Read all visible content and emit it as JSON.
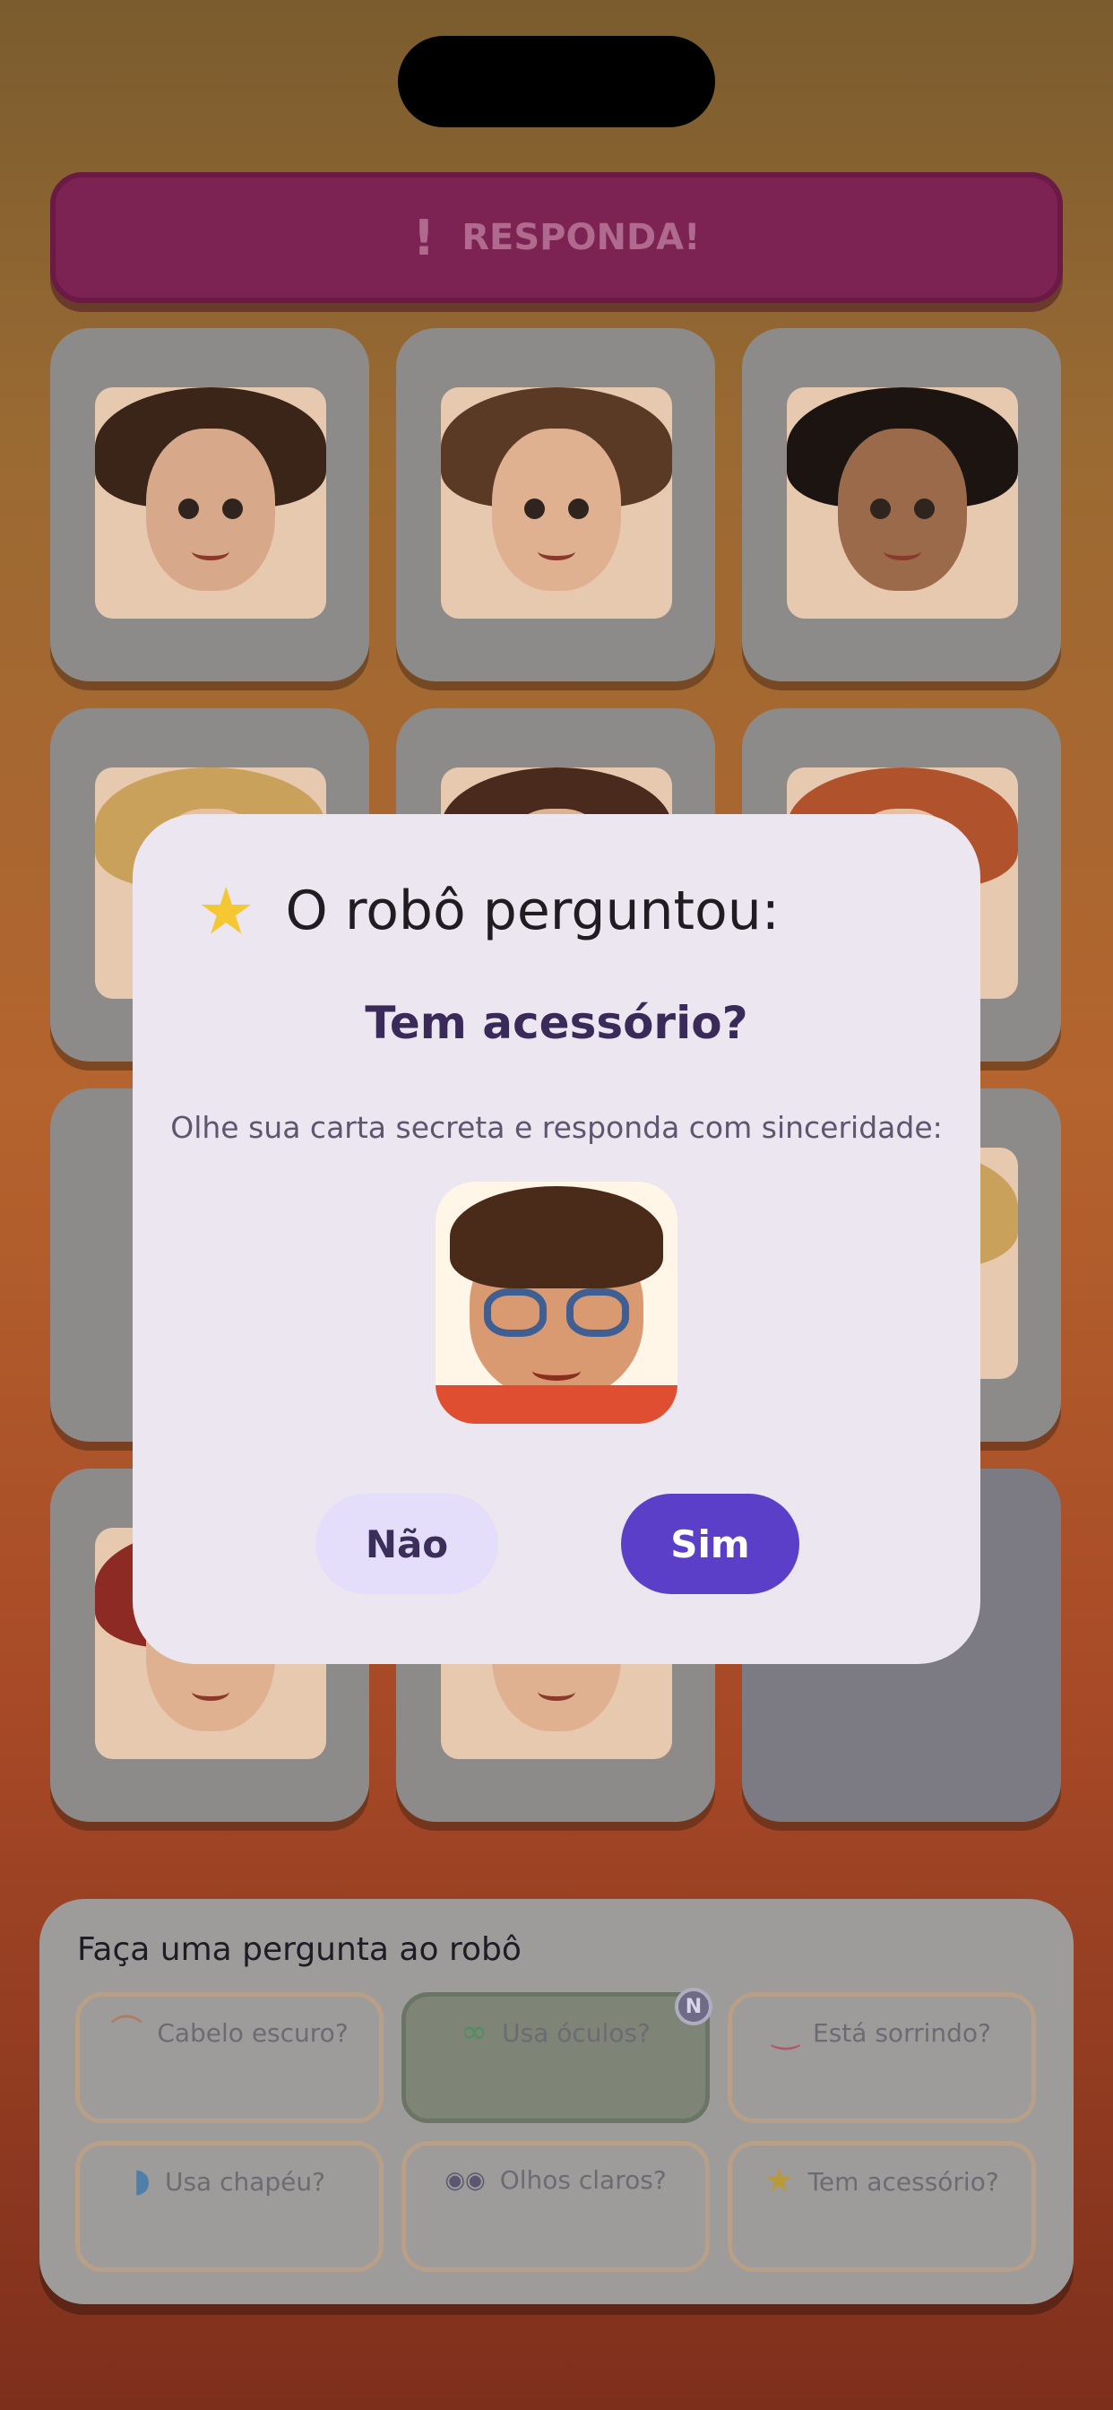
{
  "banner": {
    "icon": "exclamation-icon",
    "symbol": "!",
    "label": "RESPONDA!"
  },
  "cards": [
    {
      "hair": "#3a2518",
      "skin": "#d7a98a"
    },
    {
      "hair": "#5a3a24",
      "skin": "#e0b191"
    },
    {
      "hair": "#1b1410",
      "skin": "#9a6a4a"
    },
    {
      "hair": "#c9a15a",
      "skin": "#e7c0a0"
    },
    {
      "hair": "#4a2a1c",
      "skin": "#dcb292"
    },
    {
      "hair": "#b0532c",
      "skin": "#e8bfa0"
    },
    {
      "hair": "#8d8b8a",
      "skin": "#8d8b8a"
    },
    {
      "hair": "#8d8b8a",
      "skin": "#8d8b8a"
    },
    {
      "hair": "#c9a15a",
      "skin": "#e7c0a0"
    },
    {
      "hair": "#8e2a24",
      "skin": "#e0b191"
    },
    {
      "hair": "#4a2a1c",
      "skin": "#e0b191"
    },
    {
      "hair": "#7c7a82",
      "skin": "#7c7a82"
    }
  ],
  "modal": {
    "star_icon": "star-icon",
    "star": "★",
    "title": "O robô perguntou:",
    "question": "Tem acessório?",
    "instruction": "Olhe sua carta secreta e responda com sinceridade:",
    "no_label": "Não",
    "yes_label": "Sim"
  },
  "panel": {
    "title": "Faça uma pergunta ao robô",
    "options": [
      {
        "icon": "hair-icon",
        "glyph": "⌒",
        "label": "Cabelo escuro?",
        "selected": false
      },
      {
        "icon": "glasses-icon",
        "glyph": "∞",
        "label": "Usa óculos?",
        "selected": true,
        "badge": "N"
      },
      {
        "icon": "smile-icon",
        "glyph": "‿",
        "label": "Está sorrindo?",
        "selected": false
      },
      {
        "icon": "cap-icon",
        "glyph": "◗",
        "label": "Usa chapéu?",
        "selected": false
      },
      {
        "icon": "eyes-icon",
        "glyph": "◉◉",
        "label": "Olhos claros?",
        "selected": false
      },
      {
        "icon": "star-icon",
        "glyph": "★",
        "label": "Tem acessório?",
        "selected": false
      }
    ]
  }
}
